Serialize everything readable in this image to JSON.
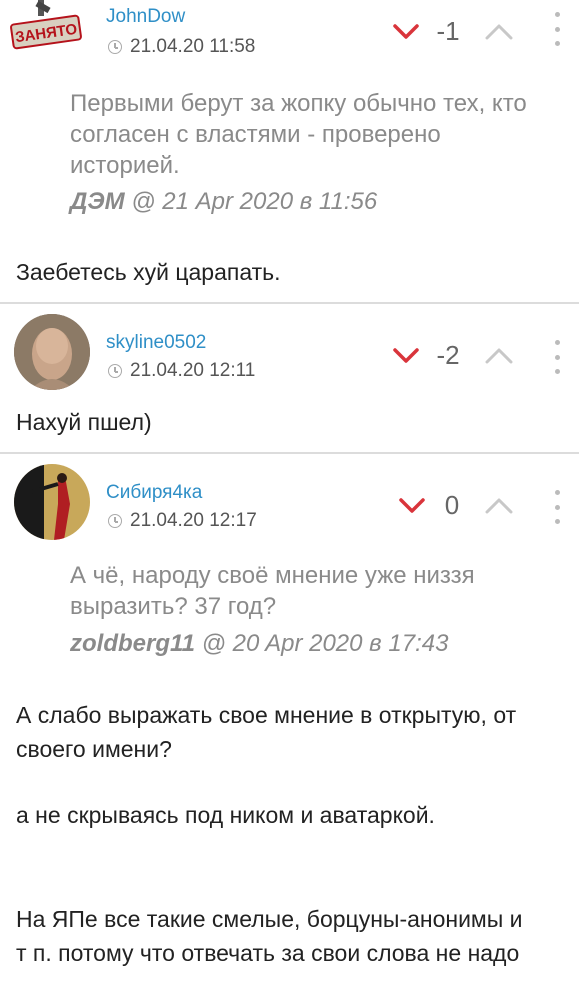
{
  "comments": [
    {
      "author": "JohnDow",
      "avatar_badge": "ЗАНЯТО",
      "timestamp": "21.04.20 11:58",
      "score": "-1",
      "quote": {
        "text": "Первыми берут за жопку обычно тех, кто согласен с властями - проверено историей.",
        "author": "ДЭМ",
        "date": "@ 21 Apr 2020 в 11:56"
      },
      "text_lines": [
        "Заебетесь хуй царапать."
      ]
    },
    {
      "author": "skyline0502",
      "timestamp": "21.04.20 12:11",
      "score": "-2",
      "text_lines": [
        "Нахуй пшел)"
      ]
    },
    {
      "author": "Сибиря4ка",
      "timestamp": "21.04.20 12:17",
      "score": "0",
      "quote": {
        "text": "А чё, народу своё мнение уже низзя выразить? 37 год?",
        "author": "zoldberg11",
        "date": "@ 20 Apr 2020 в 17:43"
      },
      "text_lines": [
        "А слабо выражать свое мнение в открытую, от своего имени?",
        "а не скрываясь под ником и аватаркой.",
        "На ЯПе все такие смелые, борцуны-анонимы и т п. потому что отвечать за свои слова не надо"
      ]
    }
  ],
  "colors": {
    "author": "#2f8fc7",
    "downvote": "#d9343b",
    "upvote": "#c8c8c8",
    "quote": "#8a8a8a",
    "divider": "#dcdcdc"
  },
  "icons": [
    "clock-icon",
    "chevron-down-icon",
    "chevron-up-icon",
    "more-vertical-icon"
  ]
}
